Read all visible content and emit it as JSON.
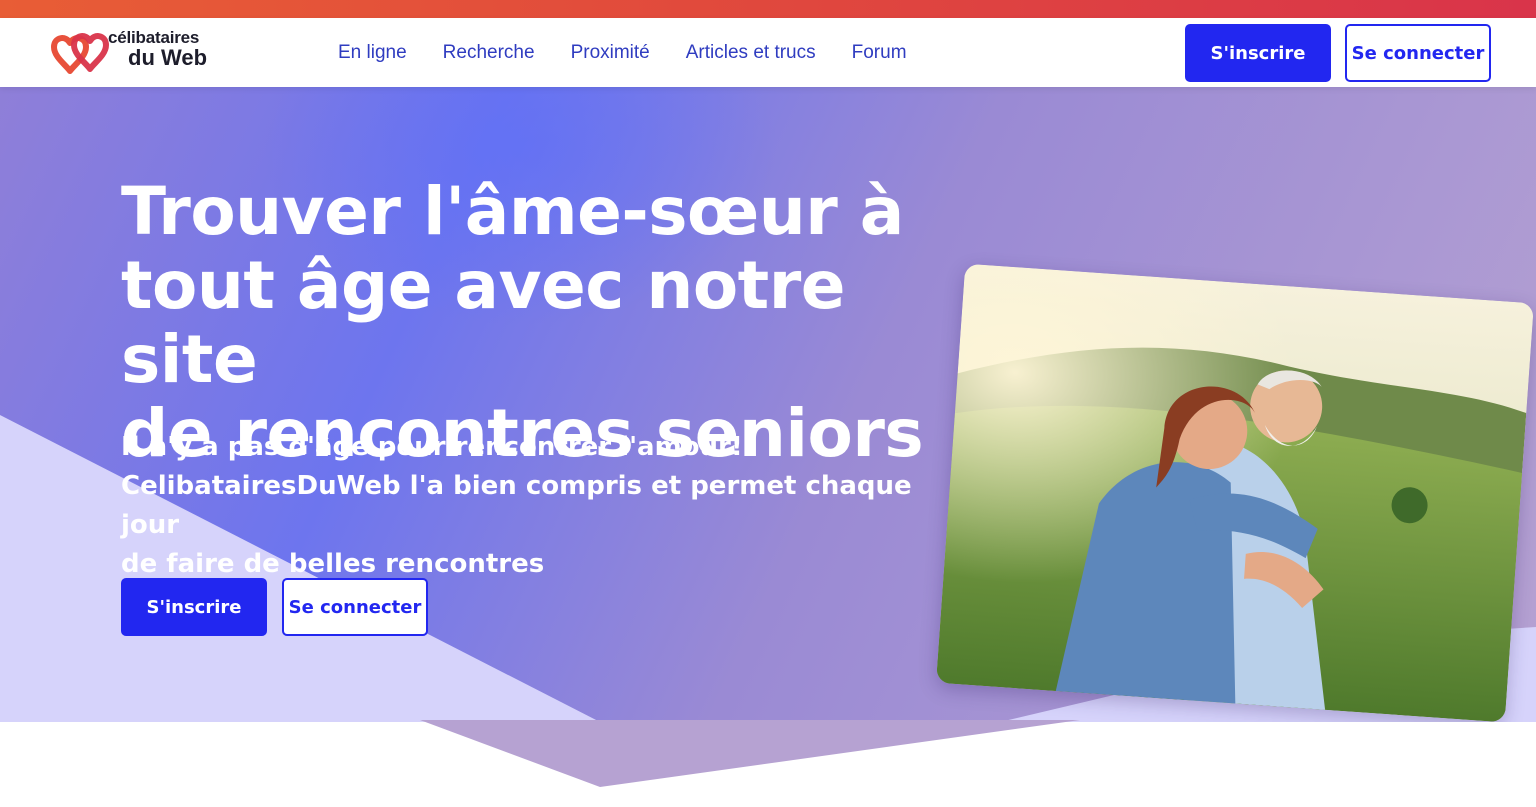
{
  "brand": {
    "line1": "célibataires",
    "line2": "du Web",
    "heart_color_left": "#e8513c",
    "heart_color_right": "#d9344a"
  },
  "nav": {
    "links": [
      {
        "label": "En ligne"
      },
      {
        "label": "Recherche"
      },
      {
        "label": "Proximité"
      },
      {
        "label": "Articles et trucs"
      },
      {
        "label": "Forum"
      }
    ],
    "signup_label": "S'inscrire",
    "login_label": "Se connecter"
  },
  "hero": {
    "title_lines": [
      "Trouver l'âme-sœur à",
      "tout âge avec notre site",
      "de rencontres seniors"
    ],
    "subtitle_lines": [
      "Il n'y a pas d'âge pour rencontrer l'amour!",
      "CelibatairesDuWeb l'a bien compris et permet chaque jour",
      "de faire de belles rencontres"
    ],
    "signup_label": "S'inscrire",
    "login_label": "Se connecter"
  },
  "colors": {
    "accent": "#2227f0",
    "nav_link": "#2f3cc0",
    "top_strip": "#e14a3c"
  }
}
